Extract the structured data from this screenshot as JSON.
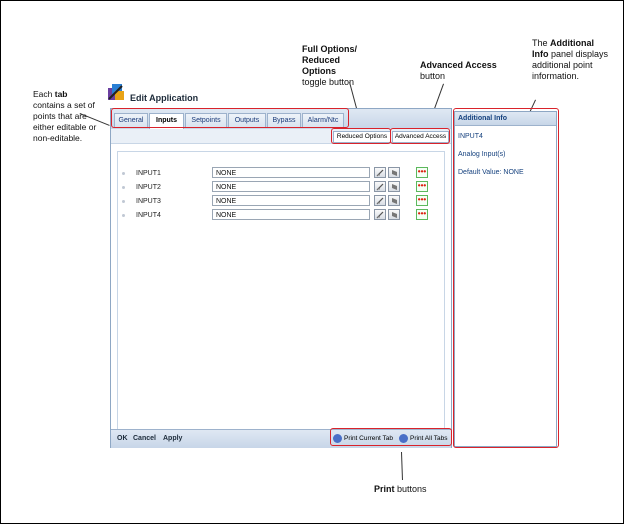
{
  "annotations": {
    "tabs_bold": "tab",
    "tabs_lines": [
      "Each ",
      " contains a set of",
      "points that are",
      "either editable or",
      "non-editable."
    ],
    "options_title": "Full Options/ Reduced Options",
    "options_sub": "toggle button",
    "advanced_title": "Advanced Access",
    "advanced_sub": "button",
    "info_lines": [
      "The ",
      "Additional",
      "Info",
      " panel displays",
      "additional point",
      "information."
    ],
    "print_bold": "Print",
    "print_rest": " buttons"
  },
  "app": {
    "title": "Edit Application",
    "tabs": [
      "General",
      "Inputs",
      "Setpoints",
      "Outputs",
      "Bypass",
      "Alarm/Ntc"
    ],
    "active_tab": "Inputs",
    "reduced_options_label": "Reduced Options",
    "advanced_access_label": "Advanced Access",
    "rows": [
      {
        "label": "INPUT1",
        "value": "NONE"
      },
      {
        "label": "INPUT2",
        "value": "NONE"
      },
      {
        "label": "INPUT3",
        "value": "NONE"
      },
      {
        "label": "INPUT4",
        "value": "NONE"
      }
    ],
    "more_label": "•••",
    "footer": {
      "ok": "OK",
      "cancel": "Cancel",
      "apply": "Apply",
      "print_current": "Print Current Tab",
      "print_all": "Print All Tabs"
    }
  },
  "info_panel": {
    "title": "Additional Info",
    "point": "INPUT4",
    "type": "Analog Input(s)",
    "default": "Default Value: NONE"
  },
  "colors": {
    "highlight": "#d9232b",
    "accent": "#15417e"
  }
}
